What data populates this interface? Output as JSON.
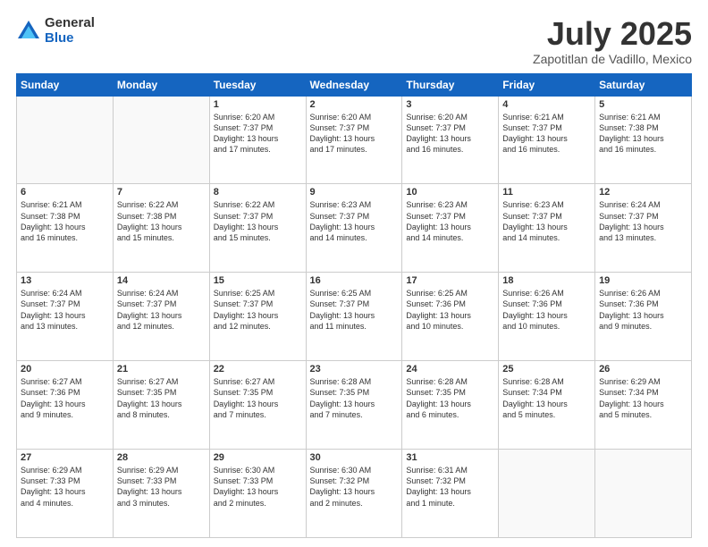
{
  "logo": {
    "general": "General",
    "blue": "Blue"
  },
  "header": {
    "month": "July 2025",
    "location": "Zapotitlan de Vadillo, Mexico"
  },
  "days_of_week": [
    "Sunday",
    "Monday",
    "Tuesday",
    "Wednesday",
    "Thursday",
    "Friday",
    "Saturday"
  ],
  "weeks": [
    [
      {
        "day": "",
        "info": ""
      },
      {
        "day": "",
        "info": ""
      },
      {
        "day": "1",
        "info": "Sunrise: 6:20 AM\nSunset: 7:37 PM\nDaylight: 13 hours\nand 17 minutes."
      },
      {
        "day": "2",
        "info": "Sunrise: 6:20 AM\nSunset: 7:37 PM\nDaylight: 13 hours\nand 17 minutes."
      },
      {
        "day": "3",
        "info": "Sunrise: 6:20 AM\nSunset: 7:37 PM\nDaylight: 13 hours\nand 16 minutes."
      },
      {
        "day": "4",
        "info": "Sunrise: 6:21 AM\nSunset: 7:37 PM\nDaylight: 13 hours\nand 16 minutes."
      },
      {
        "day": "5",
        "info": "Sunrise: 6:21 AM\nSunset: 7:38 PM\nDaylight: 13 hours\nand 16 minutes."
      }
    ],
    [
      {
        "day": "6",
        "info": "Sunrise: 6:21 AM\nSunset: 7:38 PM\nDaylight: 13 hours\nand 16 minutes."
      },
      {
        "day": "7",
        "info": "Sunrise: 6:22 AM\nSunset: 7:38 PM\nDaylight: 13 hours\nand 15 minutes."
      },
      {
        "day": "8",
        "info": "Sunrise: 6:22 AM\nSunset: 7:37 PM\nDaylight: 13 hours\nand 15 minutes."
      },
      {
        "day": "9",
        "info": "Sunrise: 6:23 AM\nSunset: 7:37 PM\nDaylight: 13 hours\nand 14 minutes."
      },
      {
        "day": "10",
        "info": "Sunrise: 6:23 AM\nSunset: 7:37 PM\nDaylight: 13 hours\nand 14 minutes."
      },
      {
        "day": "11",
        "info": "Sunrise: 6:23 AM\nSunset: 7:37 PM\nDaylight: 13 hours\nand 14 minutes."
      },
      {
        "day": "12",
        "info": "Sunrise: 6:24 AM\nSunset: 7:37 PM\nDaylight: 13 hours\nand 13 minutes."
      }
    ],
    [
      {
        "day": "13",
        "info": "Sunrise: 6:24 AM\nSunset: 7:37 PM\nDaylight: 13 hours\nand 13 minutes."
      },
      {
        "day": "14",
        "info": "Sunrise: 6:24 AM\nSunset: 7:37 PM\nDaylight: 13 hours\nand 12 minutes."
      },
      {
        "day": "15",
        "info": "Sunrise: 6:25 AM\nSunset: 7:37 PM\nDaylight: 13 hours\nand 12 minutes."
      },
      {
        "day": "16",
        "info": "Sunrise: 6:25 AM\nSunset: 7:37 PM\nDaylight: 13 hours\nand 11 minutes."
      },
      {
        "day": "17",
        "info": "Sunrise: 6:25 AM\nSunset: 7:36 PM\nDaylight: 13 hours\nand 10 minutes."
      },
      {
        "day": "18",
        "info": "Sunrise: 6:26 AM\nSunset: 7:36 PM\nDaylight: 13 hours\nand 10 minutes."
      },
      {
        "day": "19",
        "info": "Sunrise: 6:26 AM\nSunset: 7:36 PM\nDaylight: 13 hours\nand 9 minutes."
      }
    ],
    [
      {
        "day": "20",
        "info": "Sunrise: 6:27 AM\nSunset: 7:36 PM\nDaylight: 13 hours\nand 9 minutes."
      },
      {
        "day": "21",
        "info": "Sunrise: 6:27 AM\nSunset: 7:35 PM\nDaylight: 13 hours\nand 8 minutes."
      },
      {
        "day": "22",
        "info": "Sunrise: 6:27 AM\nSunset: 7:35 PM\nDaylight: 13 hours\nand 7 minutes."
      },
      {
        "day": "23",
        "info": "Sunrise: 6:28 AM\nSunset: 7:35 PM\nDaylight: 13 hours\nand 7 minutes."
      },
      {
        "day": "24",
        "info": "Sunrise: 6:28 AM\nSunset: 7:35 PM\nDaylight: 13 hours\nand 6 minutes."
      },
      {
        "day": "25",
        "info": "Sunrise: 6:28 AM\nSunset: 7:34 PM\nDaylight: 13 hours\nand 5 minutes."
      },
      {
        "day": "26",
        "info": "Sunrise: 6:29 AM\nSunset: 7:34 PM\nDaylight: 13 hours\nand 5 minutes."
      }
    ],
    [
      {
        "day": "27",
        "info": "Sunrise: 6:29 AM\nSunset: 7:33 PM\nDaylight: 13 hours\nand 4 minutes."
      },
      {
        "day": "28",
        "info": "Sunrise: 6:29 AM\nSunset: 7:33 PM\nDaylight: 13 hours\nand 3 minutes."
      },
      {
        "day": "29",
        "info": "Sunrise: 6:30 AM\nSunset: 7:33 PM\nDaylight: 13 hours\nand 2 minutes."
      },
      {
        "day": "30",
        "info": "Sunrise: 6:30 AM\nSunset: 7:32 PM\nDaylight: 13 hours\nand 2 minutes."
      },
      {
        "day": "31",
        "info": "Sunrise: 6:31 AM\nSunset: 7:32 PM\nDaylight: 13 hours\nand 1 minute."
      },
      {
        "day": "",
        "info": ""
      },
      {
        "day": "",
        "info": ""
      }
    ]
  ]
}
